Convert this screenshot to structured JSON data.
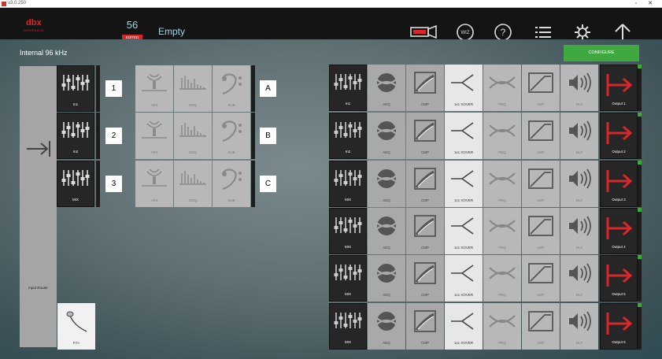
{
  "window": {
    "title": "v3.0.250",
    "controls": "◦ ✕"
  },
  "header": {
    "logo_main": "dbx",
    "logo_sub": "DRIVERACK",
    "preset_number": "56",
    "edited_badge": "EDITED",
    "preset_name": "Empty"
  },
  "toolbar": [
    "display-icon",
    "wizard-icon",
    "help-icon",
    "list-icon",
    "gear-icon",
    "home-icon"
  ],
  "sample_rate": "Internal 96 kHz",
  "configure_label": "CONFIGURE",
  "input_router_label": "Input Router",
  "inputs": [
    {
      "label": "In1",
      "number": "1"
    },
    {
      "label": "In2",
      "number": "2"
    },
    {
      "label": "MIX",
      "number": "3"
    }
  ],
  "processing_rows": [
    {
      "labels": [
        "AFS",
        "GEQ",
        "SUB"
      ],
      "letter": "A"
    },
    {
      "labels": [
        "AFS",
        "GEQ",
        "SUB"
      ],
      "letter": "B"
    },
    {
      "labels": [
        "AFS",
        "GEQ",
        "SUB"
      ],
      "letter": "C"
    }
  ],
  "rta_label": "RTA",
  "output_blocks": [
    "AEQ",
    "CMP",
    "1x1 XOVER",
    "PEQ",
    "LMT",
    "DLY"
  ],
  "outputs": [
    {
      "source": "In1",
      "name": "Output 1"
    },
    {
      "source": "In2",
      "name": "Output 2"
    },
    {
      "source": "MIX",
      "name": "Output 3"
    },
    {
      "source": "MIX",
      "name": "Output 4"
    },
    {
      "source": "MIX",
      "name": "Output 5"
    },
    {
      "source": "MIX",
      "name": "Output 6"
    }
  ],
  "colors": {
    "accent_red": "#d8262a",
    "accent_green": "#3fa83e",
    "preset_text": "#9fd6ea"
  }
}
